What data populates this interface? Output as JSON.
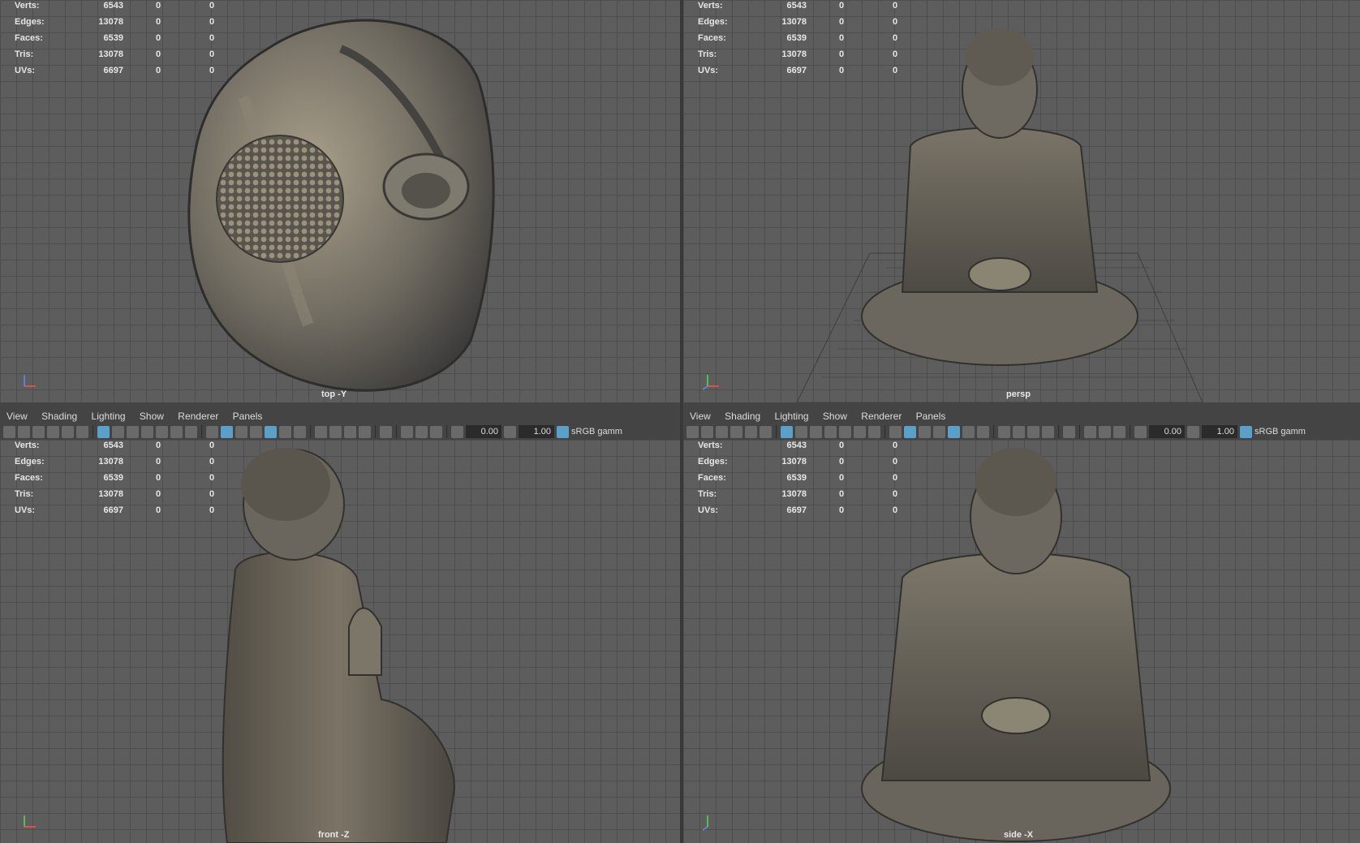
{
  "hud": {
    "verts_label": "Verts:",
    "verts": "6543",
    "edges_label": "Edges:",
    "edges": "13078",
    "faces_label": "Faces:",
    "faces": "6539",
    "tris_label": "Tris:",
    "tris": "13078",
    "uvs_label": "UVs:",
    "uvs": "6697",
    "zero": "0"
  },
  "viewports": {
    "top": {
      "camera": "top -Y"
    },
    "persp": {
      "camera": "persp"
    },
    "front": {
      "camera": "front -Z"
    },
    "side": {
      "camera": "side -X"
    }
  },
  "menu": {
    "view": "View",
    "shading": "Shading",
    "lighting": "Lighting",
    "show": "Show",
    "renderer": "Renderer",
    "panels": "Panels"
  },
  "toolbar": {
    "exposure": "0.00",
    "gamma": "1.00",
    "color_space": "sRGB gamm"
  },
  "colors": {
    "viewport_bg": "#5d5d5d",
    "grid_line": "#4e4e4e",
    "active_icon": "#5aa0c8"
  }
}
